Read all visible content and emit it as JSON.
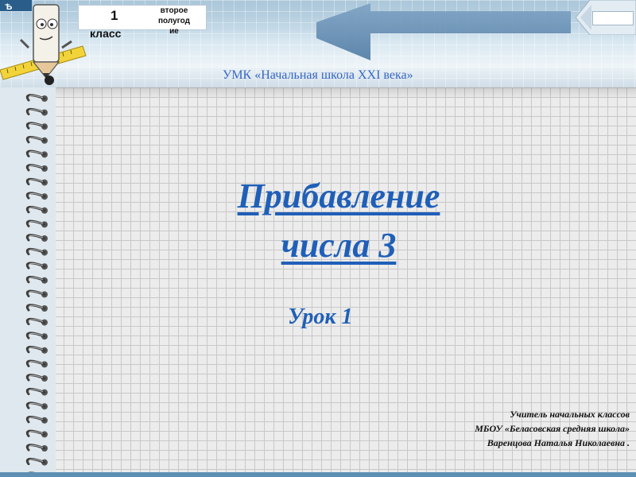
{
  "header": {
    "class_number": "1",
    "class_word": "класс",
    "semester": "второе\nполугод\nие",
    "umk": "УМК «Начальная школа XXI века»"
  },
  "title": {
    "line1": "Прибавление",
    "line2": "числа 3"
  },
  "lesson": "Урок 1",
  "teacher": {
    "line1": "Учитель начальных классов",
    "line2": "МБОУ «Беласовская средняя школа»",
    "line3": "Варенцова Наталья Николаевна ."
  },
  "colors": {
    "title": "#1f5fb8",
    "umk": "#3566c4",
    "header": "#8fb4cd",
    "bottom_bar": "#5d8fb5"
  },
  "icons": [
    "mascot-pencil-icon",
    "ruler-icon",
    "back-arrow-icon",
    "home-icon",
    "spiral-binding-icon"
  ]
}
